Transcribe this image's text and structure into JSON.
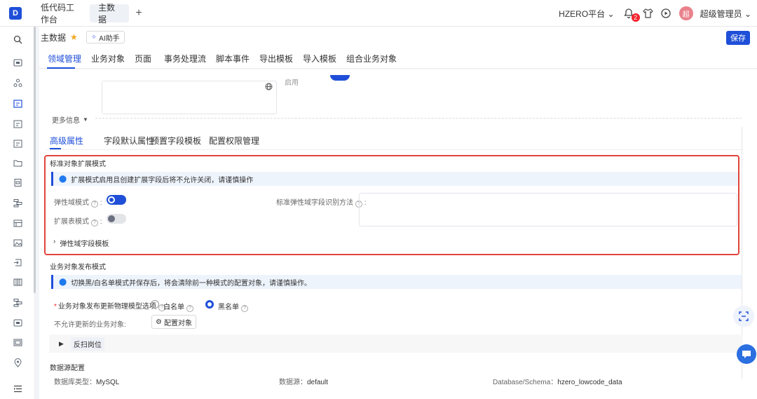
{
  "topbar": {
    "logo_text": "D",
    "tabs": [
      {
        "label": "低代码工作台",
        "active": false
      },
      {
        "label": "主数据",
        "active": true
      }
    ],
    "add_label": "+",
    "platform": "HZERO平台",
    "notification_count": "2",
    "avatar_text": "超",
    "user_name": "超级管理员"
  },
  "header": {
    "title": "主数据",
    "ai_label": "AI助手",
    "save_label": "保存"
  },
  "main_tabs": [
    "领域管理",
    "业务对象",
    "页面",
    "事务处理流",
    "脚本事件",
    "导出模板",
    "导入模板",
    "组合业务对象"
  ],
  "top_partial": {
    "label": "启用"
  },
  "more_info": "更多信息",
  "sub_tabs": [
    "高级属性",
    "字段默认属性",
    "预置字段模板",
    "配置权限管理"
  ],
  "extension": {
    "title": "标准对象扩展模式",
    "alert": "扩展模式启用且创建扩展字段后将不允许关闭，请谨慎操作",
    "elastic_label": "弹性域模式",
    "extension_table_label": "扩展表模式",
    "identify_label": "标准弹性域字段识别方法",
    "template_label": "弹性域字段模板"
  },
  "publish": {
    "title": "业务对象发布模式",
    "alert": "切换黑/白名单模式并保存后，将会清除前一种模式的配置对象，请谨慎操作。",
    "option_label": "业务对象发布更新物理模型选项",
    "whitelist": "白名单",
    "blacklist": "黑名单",
    "disallow_label": "不允许更新的业务对象:",
    "config_button": "配置对象",
    "collapse_label": "反扫岗位"
  },
  "datasource": {
    "title": "数据源配置",
    "db_type_label": "数据库类型：",
    "db_type": "MySQL",
    "source_label": "数据源：",
    "source": "default",
    "schema_label": "Database/Schema：",
    "schema": "hzero_lowcode_data"
  },
  "icons": {
    "rail": [
      "search-icon",
      "home-icon",
      "apps-icon",
      "calendar-icon",
      "calendar-icon",
      "calendar-icon",
      "folder-icon",
      "file-icon",
      "layers-icon",
      "table-icon",
      "image-icon",
      "import-icon",
      "grid-icon",
      "layers-icon",
      "monitor-icon",
      "image-icon",
      "location-icon",
      "menu-icon"
    ]
  }
}
